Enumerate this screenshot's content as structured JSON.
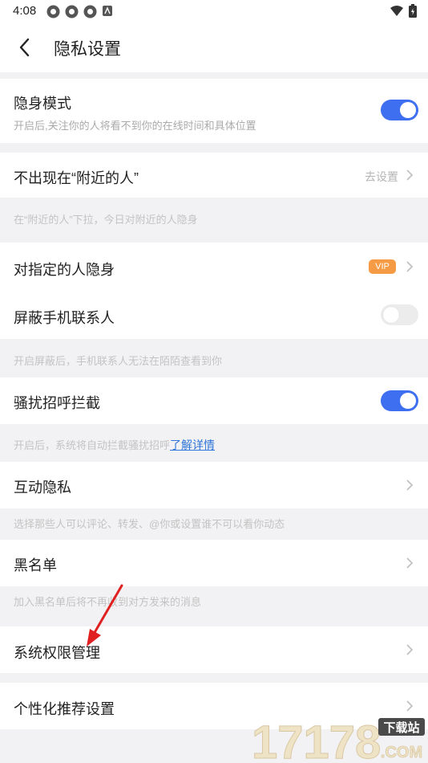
{
  "status_bar": {
    "time": "4:08"
  },
  "header": {
    "title": "隐私设置"
  },
  "items": {
    "stealth": {
      "title": "隐身模式",
      "subtitle": "开启后,关注你的人将看不到你的在线时间和具体位置",
      "toggle": "on"
    },
    "nearby": {
      "title": "不出现在“附近的人”",
      "action": "去设置",
      "hint": "在“附近的人”下拉，今日对附近的人隐身"
    },
    "specific": {
      "title": "对指定的人隐身",
      "badge": "VIP"
    },
    "contacts": {
      "title": "屏蔽手机联系人",
      "toggle": "off",
      "hint": "开启屏蔽后，手机联系人无法在陌陌查看到你"
    },
    "harass": {
      "title": "骚扰招呼拦截",
      "toggle": "on",
      "hint": "开启后，系统将自动拦截骚扰招呼",
      "link": "了解详情"
    },
    "interaction": {
      "title": "互动隐私",
      "hint": "选择那些人可以评论、转发、@你或设置谁不可以看你动态"
    },
    "blacklist": {
      "title": "黑名单",
      "hint": "加入黑名单后将不再收到对方发来的消息"
    },
    "permissions": {
      "title": "系统权限管理"
    },
    "personalized": {
      "title": "个性化推荐设置"
    }
  },
  "watermark": {
    "text": "17178",
    "badge": "下载站",
    "domain": ".COM"
  },
  "colors": {
    "accent": "#3e6ff1",
    "vip": "#f59b45",
    "link": "#2f74d8",
    "annotation": "#e02020"
  }
}
